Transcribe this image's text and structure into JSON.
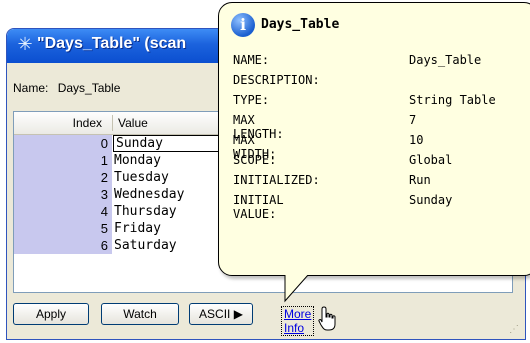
{
  "window": {
    "title": "\"Days_Table\" (scan",
    "name_label": "Name:",
    "name_value": "Days_Table",
    "grid": {
      "columns": [
        "Index",
        "Value"
      ],
      "rows": [
        {
          "index": "0",
          "value": "Sunday"
        },
        {
          "index": "1",
          "value": "Monday"
        },
        {
          "index": "2",
          "value": "Tuesday"
        },
        {
          "index": "3",
          "value": "Wednesday"
        },
        {
          "index": "4",
          "value": "Thursday"
        },
        {
          "index": "5",
          "value": "Friday"
        },
        {
          "index": "6",
          "value": "Saturday"
        }
      ]
    },
    "buttons": {
      "apply": "Apply",
      "watch": "Watch",
      "ascii": "ASCII ▶",
      "more_info": "More Info"
    }
  },
  "tooltip": {
    "title": "Days_Table",
    "icon": "info-icon",
    "fields": [
      {
        "key": "NAME:",
        "value": "Days_Table"
      },
      {
        "key": "DESCRIPTION:",
        "value": ""
      },
      {
        "key": "TYPE:",
        "value": "String Table"
      },
      {
        "key": "MAX LENGTH:",
        "value": "7"
      },
      {
        "key": "MAX WIDTH:",
        "value": "10"
      },
      {
        "key": "SCOPE:",
        "value": "Global"
      },
      {
        "key": "INITIALIZED:",
        "value": "Run"
      },
      {
        "key": "INITIAL VALUE:",
        "value": "Sunday"
      }
    ]
  },
  "colors": {
    "titlebar": "#1b62dd",
    "index_column": "#c8c8ee",
    "tooltip_bg": "#ffffe1"
  }
}
